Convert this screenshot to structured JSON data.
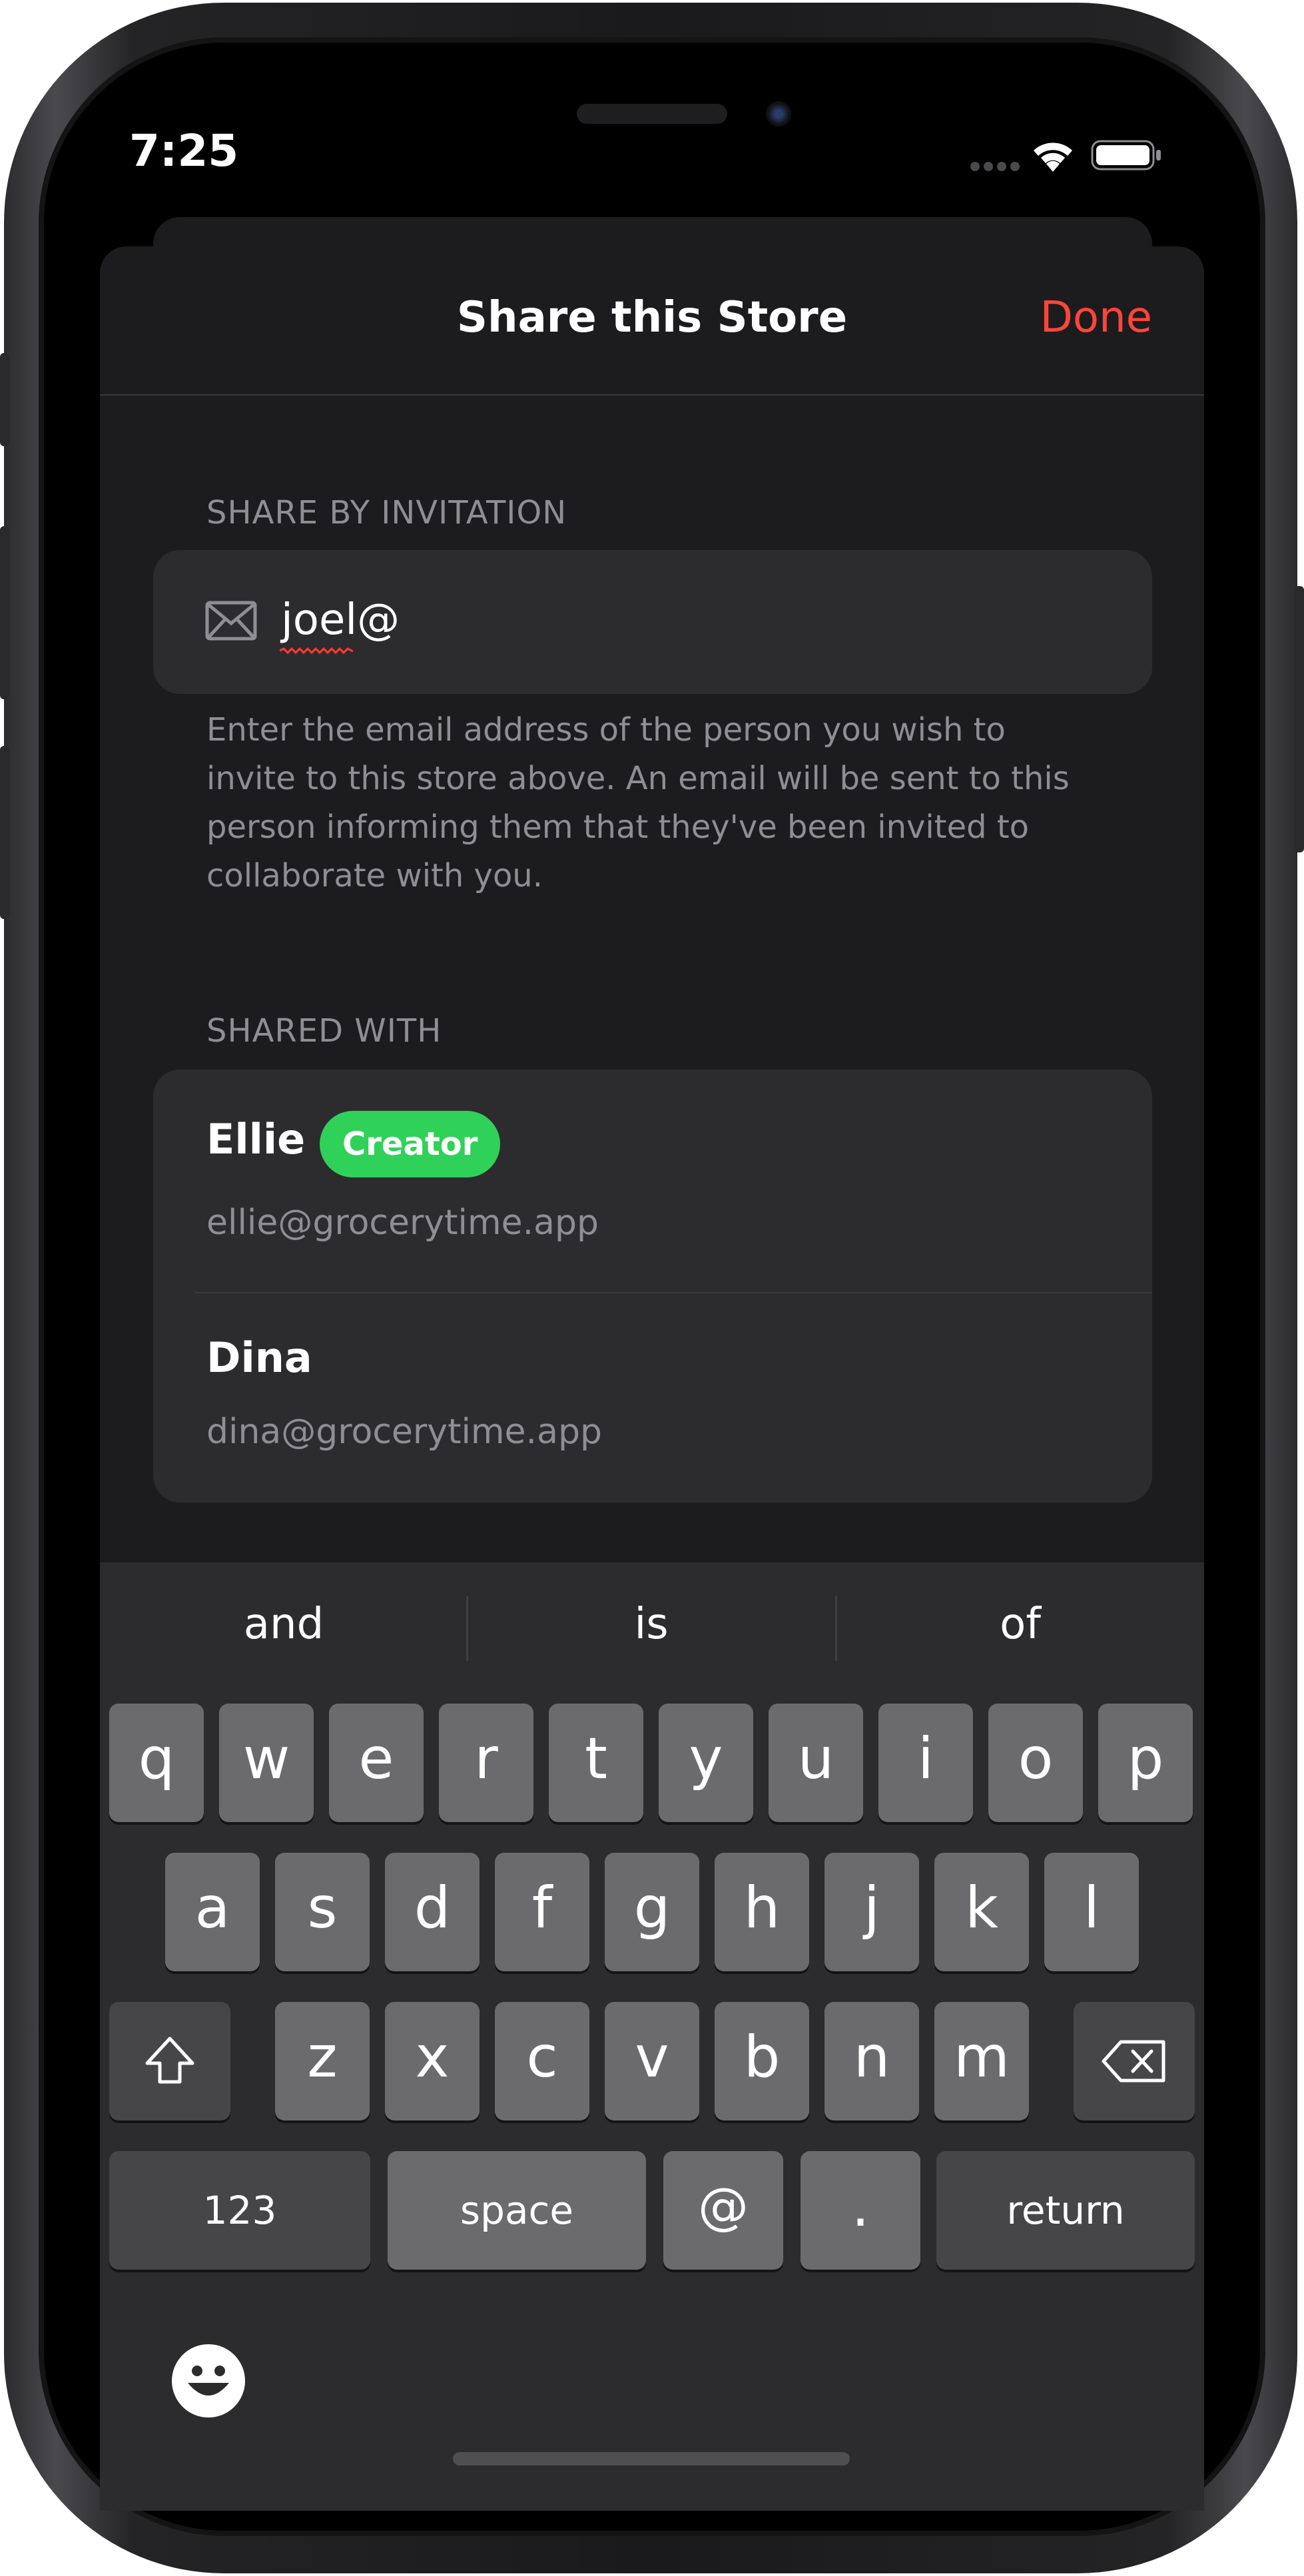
{
  "status_bar": {
    "time": "7:25"
  },
  "sheet": {
    "title": "Share this Store",
    "done_label": "Done",
    "invite_section_label": "SHARE BY INVITATION",
    "email_value": "joel@",
    "invite_footer": "Enter the email address of the person you wish to invite to this store above. An email will be sent to this person informing them that they've been invited to collaborate with you.",
    "shared_section_label": "SHARED WITH",
    "members": [
      {
        "name": "Ellie",
        "email": "ellie@grocerytime.app",
        "badge": "Creator"
      },
      {
        "name": "Dina",
        "email": "dina@grocerytime.app"
      }
    ]
  },
  "keyboard": {
    "suggestions": [
      "and",
      "is",
      "of"
    ],
    "row1": [
      "q",
      "w",
      "e",
      "r",
      "t",
      "y",
      "u",
      "i",
      "o",
      "p"
    ],
    "row2": [
      "a",
      "s",
      "d",
      "f",
      "g",
      "h",
      "j",
      "k",
      "l"
    ],
    "row3": [
      "z",
      "x",
      "c",
      "v",
      "b",
      "n",
      "m"
    ],
    "numbers_key": "123",
    "space_key": "space",
    "at_key": "@",
    "period_key": ".",
    "return_key": "return"
  },
  "colors": {
    "accent_done": "#ff453a",
    "creator_badge": "#30d158",
    "sheet_background": "#1c1c1e",
    "card_background": "#2c2c2e"
  },
  "icons": [
    "envelope-icon",
    "shift-icon",
    "delete-icon",
    "emoji-icon",
    "wifi-icon",
    "battery-icon",
    "cellular-icon"
  ]
}
